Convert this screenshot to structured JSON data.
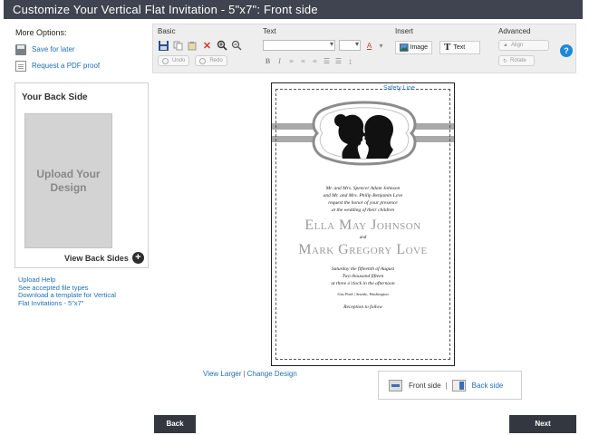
{
  "title": "Customize Your Vertical Flat Invitation - 5\"x7\": Front side",
  "more_options": {
    "header": "More Options:",
    "save": "Save for later",
    "pdf": "Request a PDF proof"
  },
  "toolbar": {
    "basic": {
      "label": "Basic",
      "undo": "Undo",
      "redo": "Redo"
    },
    "text": {
      "label": "Text"
    },
    "insert": {
      "label": "Insert",
      "image": "Image",
      "text_btn": "Text"
    },
    "advanced": {
      "label": "Advanced",
      "align": "Align",
      "rotate": "Rotate"
    },
    "help": "?"
  },
  "back_side": {
    "title": "Your Back Side",
    "upload": "Upload Your Design",
    "view_back": "View Back Sides"
  },
  "help_links": [
    "Upload Help",
    "See accepted file types",
    "Download a template for Vertical",
    "Flat Invitations - 5\"x7\""
  ],
  "invitation": {
    "safety": "Safety Line",
    "hosts_1": "Mr. and Mrs. Spencer Adam Johnson",
    "hosts_2": "and Mr. and Mrs. Philip Benjamin Love",
    "request_1": "request the honor of your presence",
    "request_2": "at the wedding of their children",
    "bride": "Ella May Johnson",
    "and": "and",
    "groom": "Mark Gregory Love",
    "date_1": "Saturday the fifteenth of August",
    "date_2": "Two thousand fifteen",
    "date_3": "at three o'clock in the afternoon",
    "place": "Gas Park | Seattle, Washington",
    "reception": "Reception to follow"
  },
  "preview_links": {
    "view_larger": "View Larger",
    "sep": "|",
    "change": "Change Design"
  },
  "sides": {
    "front": "Front side",
    "sep": "|",
    "back": "Back side"
  },
  "nav": {
    "back": "Back",
    "next": "Next"
  }
}
